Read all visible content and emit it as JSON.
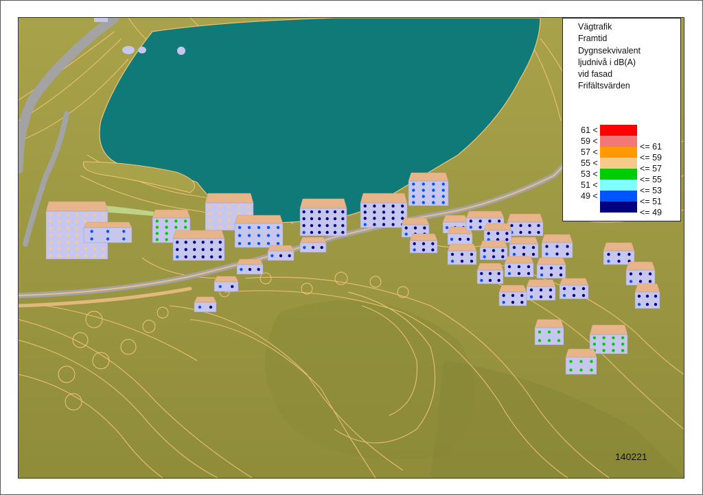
{
  "legend": {
    "title_lines": [
      "Vägtrafik",
      "Framtid",
      "Dygnsekvivalent",
      "ljudnivå i dB(A)",
      "vid fasad",
      "Frifältsvärden"
    ],
    "classes": [
      {
        "lower": "61 <",
        "upper": "",
        "color": "#ff0000"
      },
      {
        "lower": "59 <",
        "upper": "<= 61",
        "color": "#f27878"
      },
      {
        "lower": "57 <",
        "upper": "<= 59",
        "color": "#ff9900"
      },
      {
        "lower": "55 <",
        "upper": "<= 57",
        "color": "#f7c98a"
      },
      {
        "lower": "53 <",
        "upper": "<= 55",
        "color": "#00cc00"
      },
      {
        "lower": "51 <",
        "upper": "<= 53",
        "color": "#80ffff"
      },
      {
        "lower": "49 <",
        "upper": "<= 51",
        "color": "#0055ff"
      },
      {
        "lower": "",
        "upper": "<= 49",
        "color": "#000080"
      }
    ]
  },
  "map": {
    "id_label": "140221",
    "colors": {
      "terrain": "#9e9b3f",
      "water": "#0f7a77",
      "road": "#a3a3a3",
      "contour": "#f5c47a",
      "roof": "#e8b48a",
      "facade": "#c6c6ee"
    }
  }
}
